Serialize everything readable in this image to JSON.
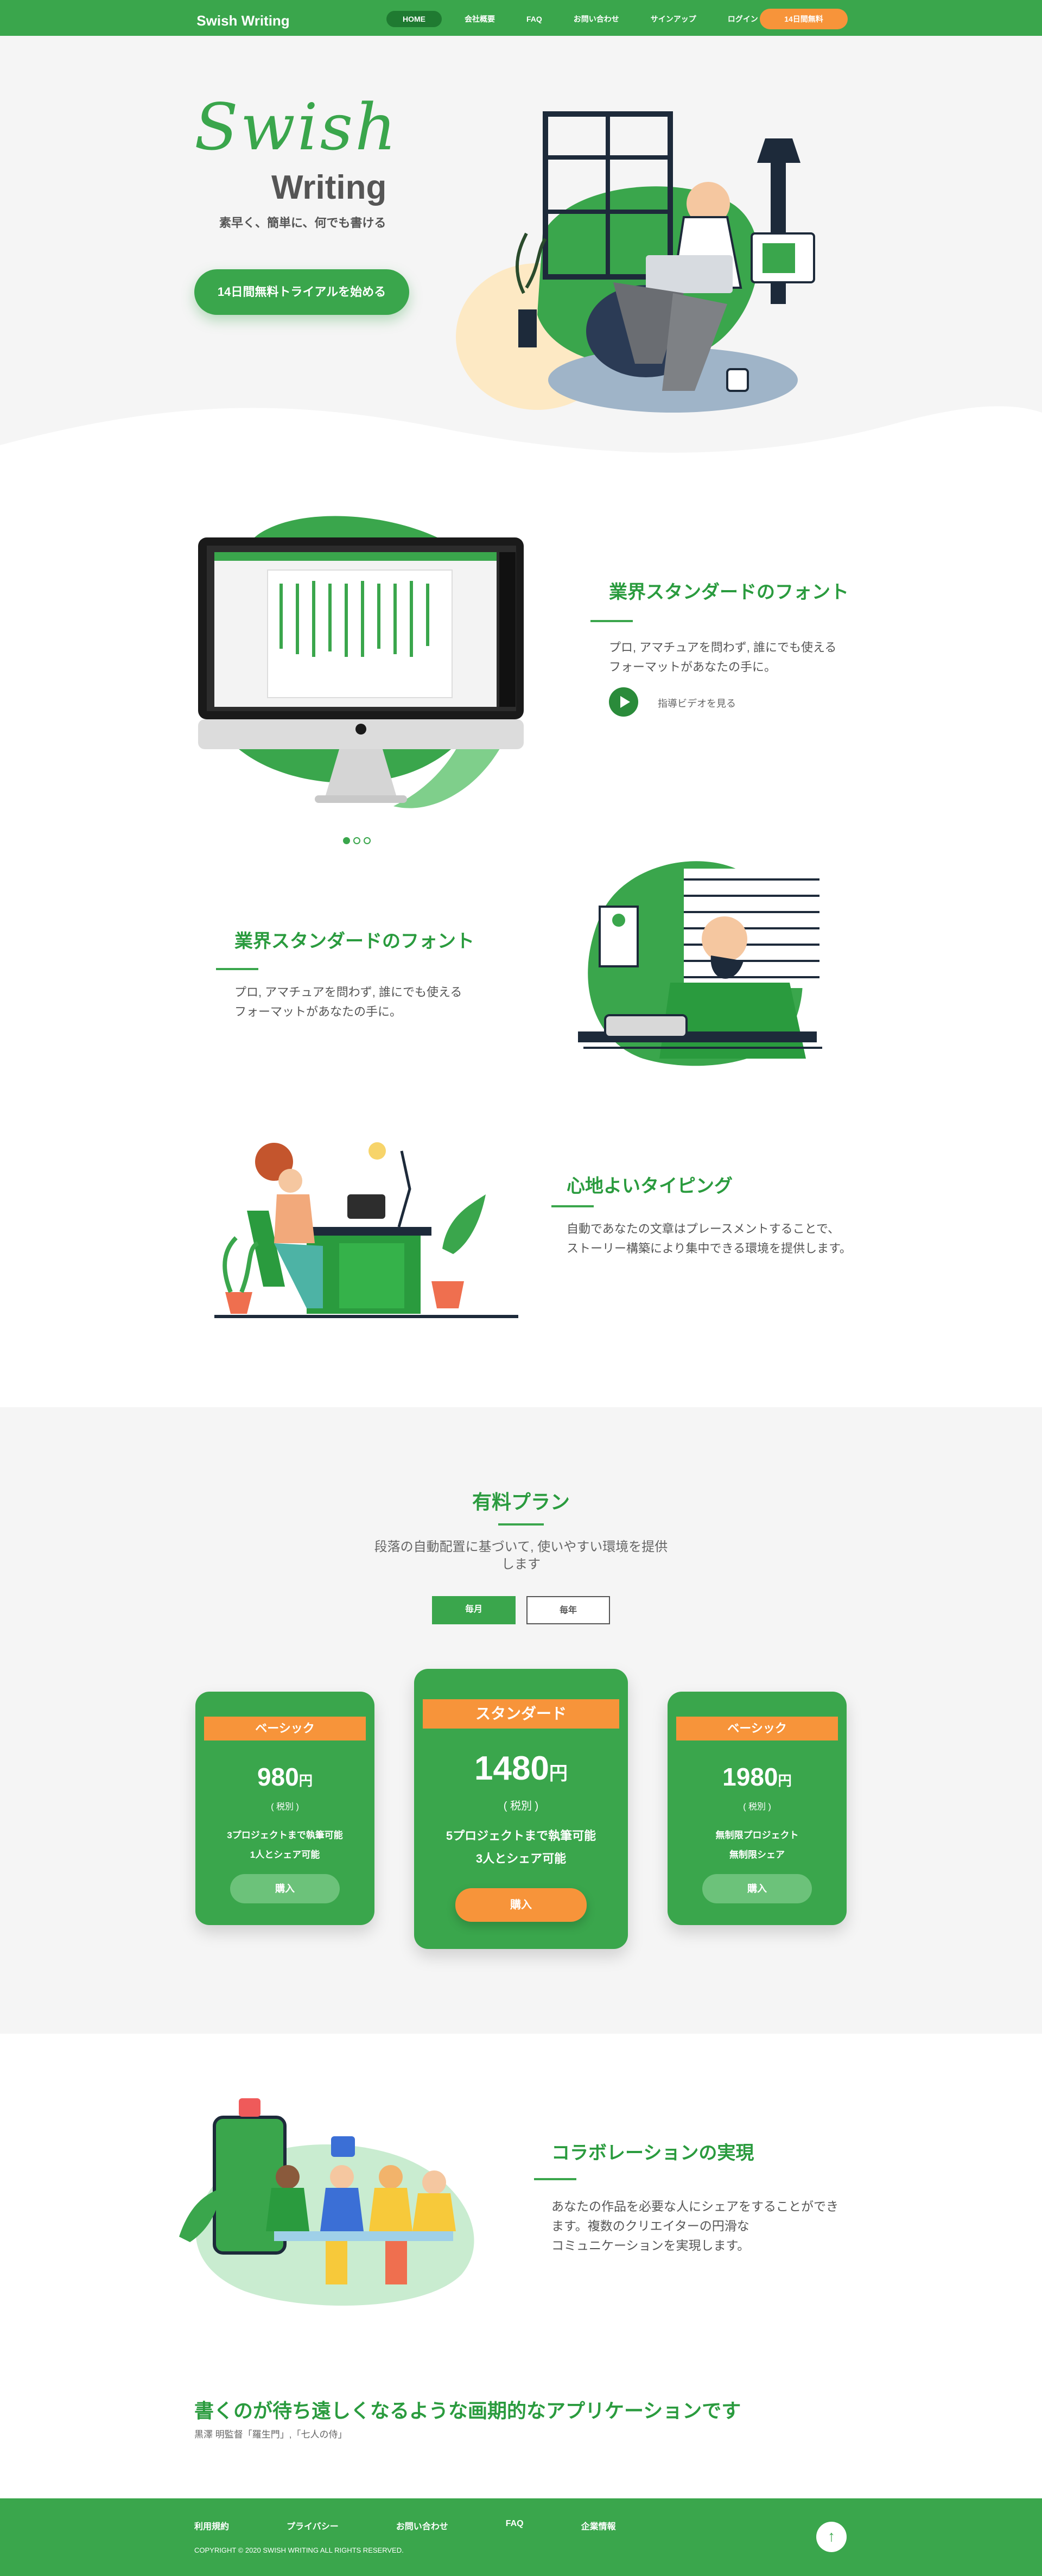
{
  "header": {
    "logo": "Swish Writing",
    "nav": [
      "HOME",
      "会社概要",
      "FAQ",
      "お問い合わせ",
      "サインアップ",
      "ログイン"
    ],
    "cta": "14日間無料"
  },
  "hero": {
    "script_word": "Swish",
    "word": "Writing",
    "tagline": "素早く、簡単に、何でも書ける",
    "button": "14日間無料トライアルを始める"
  },
  "features": [
    {
      "title": "業界スタンダードのフォント",
      "body_lines": [
        "プロ, アマチュアを問わず, 誰にでも使える",
        "フォーマットがあなたの手に。"
      ],
      "link": "指導ビデオを見る"
    },
    {
      "title": "業界スタンダードのフォント",
      "body_lines": [
        "プロ, アマチュアを問わず, 誰にでも使える",
        "フォーマットがあなたの手に。"
      ]
    },
    {
      "title": "心地よいタイピング",
      "body_lines": [
        "自動であなたの文章はプレースメントすることで、",
        "ストーリー構築により集中できる環境を提供します。"
      ]
    }
  ],
  "carousel": {
    "count": 3,
    "active": 0
  },
  "pricing": {
    "title": "有料プラン",
    "subtitle_lines": [
      "段落の自動配置に基づいて, 使いやすい環境を提供",
      "します"
    ],
    "toggle": [
      "毎月",
      "毎年"
    ],
    "plans": [
      {
        "name": "ベーシック",
        "price": "980",
        "unit": "円",
        "tax": "( 税別 )",
        "features": [
          "3プロジェクトまで執筆可能",
          "1人とシェア可能"
        ],
        "button": "購入"
      },
      {
        "name": "スタンダード",
        "price": "1480",
        "unit": "円",
        "tax": "( 税別 )",
        "features": [
          "5プロジェクトまで執筆可能",
          "3人とシェア可能"
        ],
        "button": "購入"
      },
      {
        "name": "ベーシック",
        "price": "1980",
        "unit": "円",
        "tax": "( 税別 )",
        "features": [
          "無制限プロジェクト",
          "無制限シェア"
        ],
        "button": "購入"
      }
    ]
  },
  "collab": {
    "title": "コラボレーションの実現",
    "body_lines": [
      "あなたの作品を必要な人にシェアをすることができ",
      "ます。複数のクリエイターの円滑な",
      "コミュニケーションを実現します。"
    ]
  },
  "quote": {
    "text": "書くのが待ち遠しくなるような画期的なアプリケーションです",
    "attribution": "黒澤 明監督「羅生門」,「七人の侍」"
  },
  "footer": {
    "links": [
      "利用規約",
      "プライバシー",
      "お問い合わせ",
      "FAQ",
      "企業情報"
    ],
    "copyright": "COPYRIGHT © 2020 SWISH WRITING ALL RIGHTS RESERVED.",
    "top_icon": "arrow-up-icon"
  },
  "colors": {
    "brand": "#3aa64c",
    "accent": "#f7943a",
    "bg": "#f5f5f5"
  }
}
